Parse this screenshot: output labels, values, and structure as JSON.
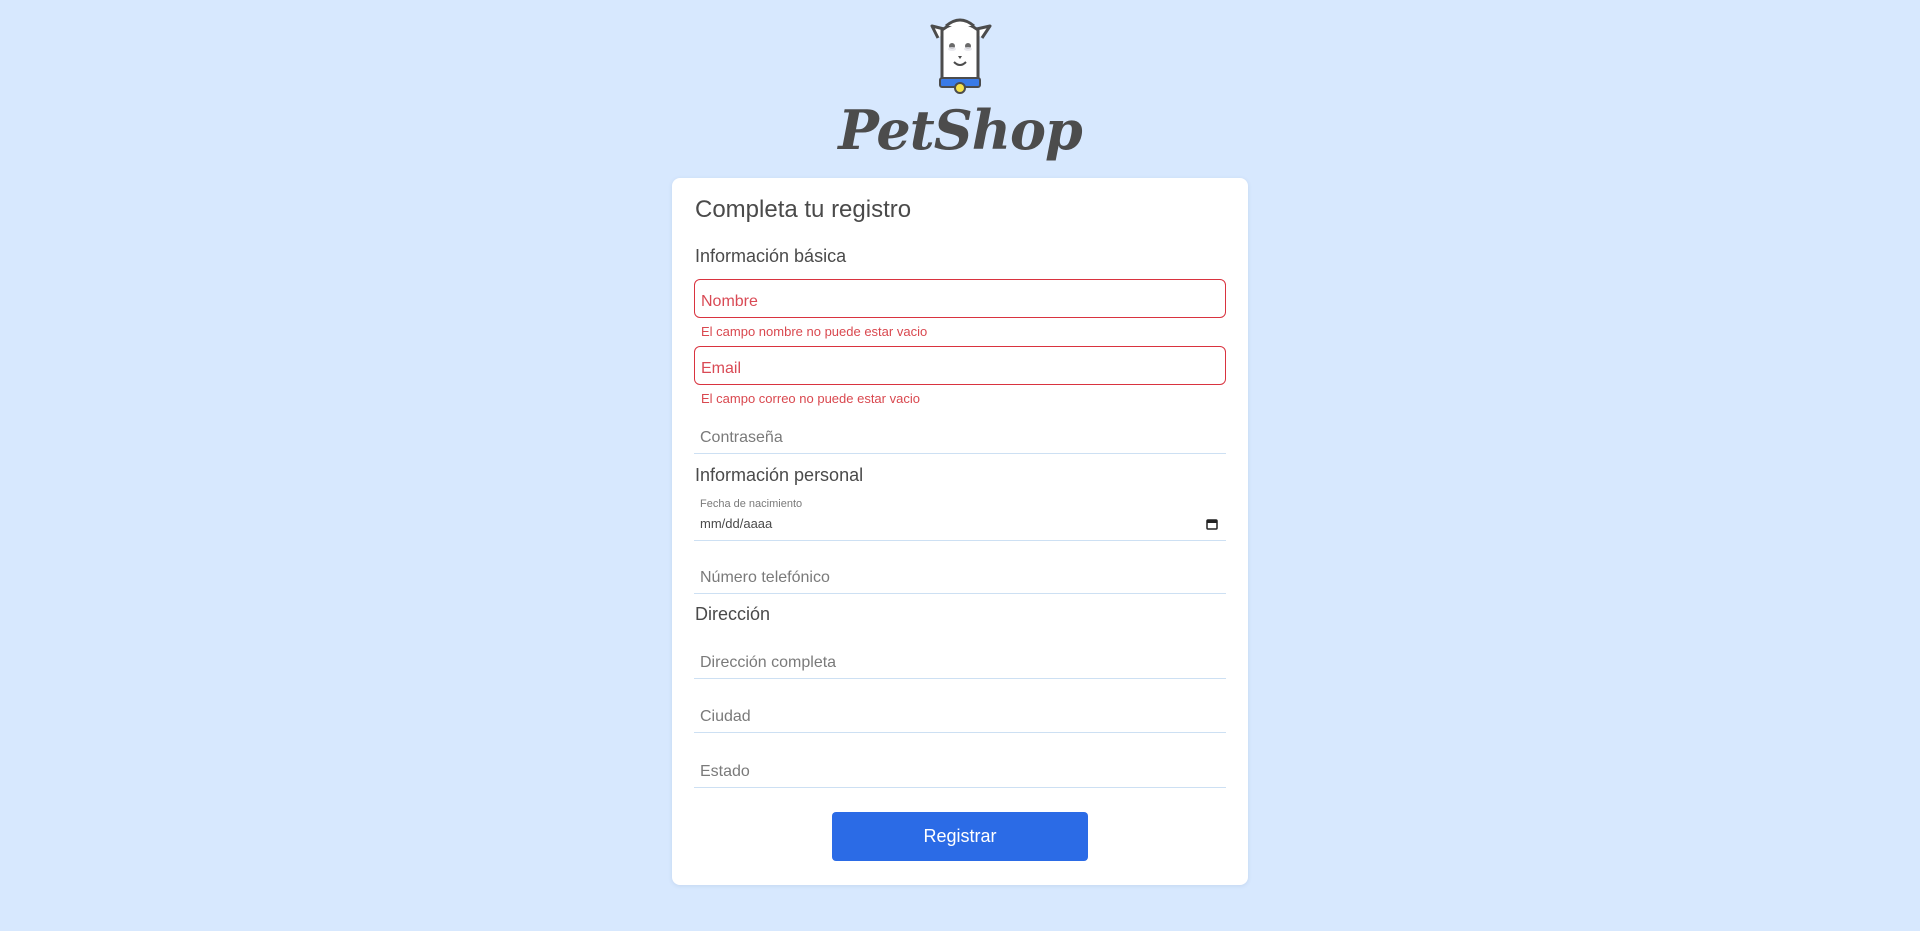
{
  "brand": {
    "logo_icon": "dog-mascot-icon",
    "name": "PetShop"
  },
  "form": {
    "title": "Completa tu registro",
    "sections": {
      "basic": "Información básica",
      "personal": "Información personal",
      "address": "Dirección"
    },
    "fields": {
      "name": {
        "placeholder": "Nombre",
        "error": "El campo nombre no puede estar vacio"
      },
      "email": {
        "placeholder": "Email",
        "error": "El campo correo no puede estar vacio"
      },
      "password": {
        "placeholder": "Contraseña"
      },
      "birthdate": {
        "label": "Fecha de nacimiento",
        "value": "mm/dd/aaaa"
      },
      "phone": {
        "placeholder": "Número telefónico"
      },
      "address": {
        "placeholder": "Dirección completa"
      },
      "city": {
        "placeholder": "Ciudad"
      },
      "state": {
        "placeholder": "Estado"
      }
    },
    "submit_label": "Registrar"
  },
  "colors": {
    "background": "#d7e8fe",
    "accent": "#2b6be6",
    "error": "#d9333f"
  }
}
